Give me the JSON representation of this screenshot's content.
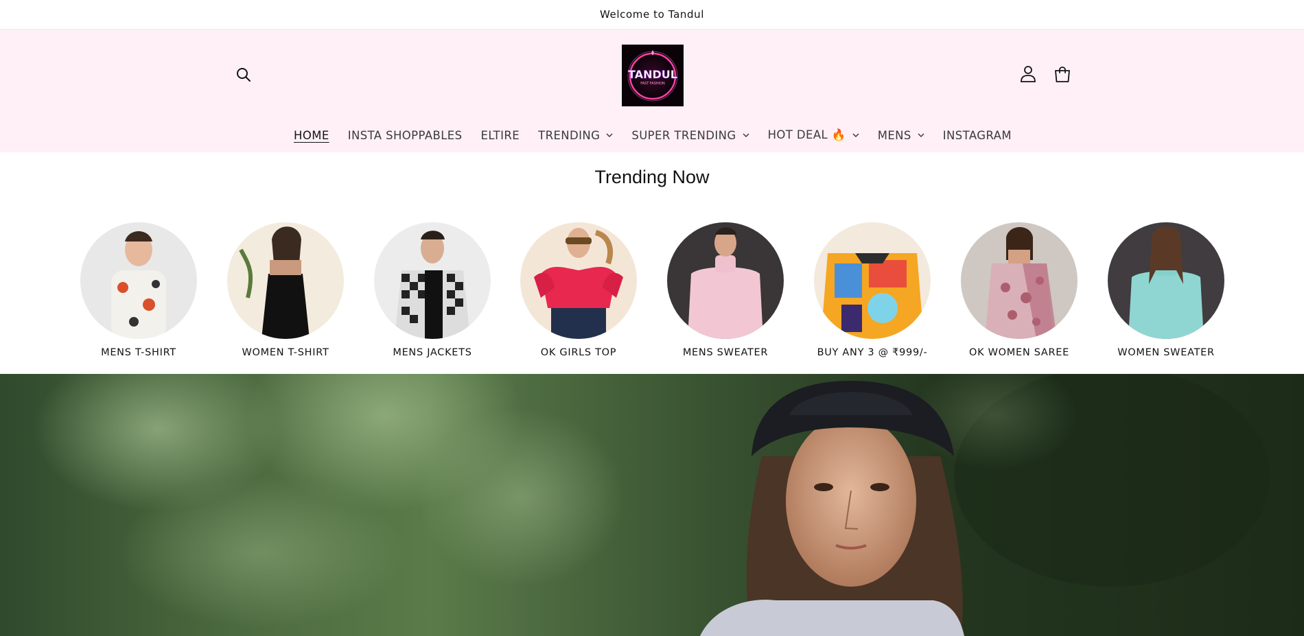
{
  "announcement": {
    "text": "Welcome to Tandul"
  },
  "header": {
    "logo": {
      "brand": "TANDUL",
      "tagline": "FAST FASHION"
    },
    "nav": [
      {
        "label": "HOME",
        "active": true,
        "dropdown": false
      },
      {
        "label": "INSTA SHOPPABLES",
        "active": false,
        "dropdown": false
      },
      {
        "label": "ELTIRE",
        "active": false,
        "dropdown": false
      },
      {
        "label": "TRENDING",
        "active": false,
        "dropdown": true
      },
      {
        "label": "SUPER TRENDING",
        "active": false,
        "dropdown": true
      },
      {
        "label": "HOT DEAL 🔥",
        "active": false,
        "dropdown": true
      },
      {
        "label": "MENS",
        "active": false,
        "dropdown": true
      },
      {
        "label": "INSTAGRAM",
        "active": false,
        "dropdown": false
      }
    ],
    "icons": {
      "search": "search-icon",
      "account": "account-icon",
      "cart": "cart-icon"
    }
  },
  "trending": {
    "title": "Trending Now",
    "collections": [
      {
        "label": "MENS T-SHIRT",
        "image": "man in printed t-shirt"
      },
      {
        "label": "WOMEN T-SHIRT",
        "image": "woman in black halter dress"
      },
      {
        "label": "MENS JACKETS",
        "image": "man in checked jacket"
      },
      {
        "label": "OK GIRLS TOP",
        "image": "woman in pink ruffle top"
      },
      {
        "label": "MENS SWEATER",
        "image": "man in pink turtleneck"
      },
      {
        "label": "BUY ANY 3 @ ₹999/-",
        "image": "printed graphic shirt"
      },
      {
        "label": "OK WOMEN SAREE",
        "image": "woman in floral saree"
      },
      {
        "label": "WOMEN SWEATER",
        "image": "woman in mint turtleneck"
      }
    ]
  },
  "hero": {
    "image": "woman in black bucket hat in forest"
  },
  "colors": {
    "header_bg": "#fff0f7",
    "text": "#121212",
    "logo_accent": "#ff3fa8"
  }
}
